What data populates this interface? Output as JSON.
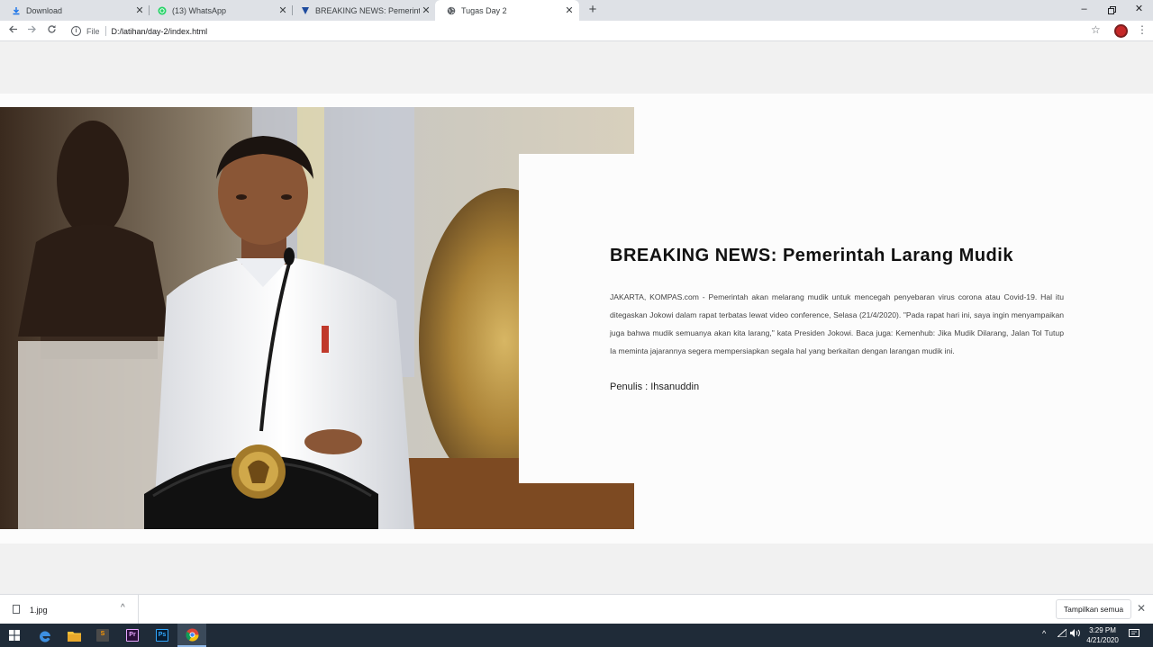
{
  "browser": {
    "tabs": [
      {
        "title": "Download",
        "icon": "download-icon",
        "active": false
      },
      {
        "title": "(13) WhatsApp",
        "icon": "whatsapp-icon",
        "active": false
      },
      {
        "title": "BREAKING NEWS: Pemerintah La",
        "icon": "news-favicon-icon",
        "active": false
      },
      {
        "title": "Tugas Day 2",
        "icon": "globe-icon",
        "active": true
      }
    ],
    "address": {
      "protocol": "File",
      "url": "D:/latihan/day-2/index.html"
    }
  },
  "article": {
    "headline": "BREAKING NEWS: Pemerintah Larang Mudik",
    "body": "JAKARTA, KOMPAS.com - Pemerintah akan melarang mudik untuk mencegah penyebaran virus corona atau Covid-19. Hal itu ditegaskan Jokowi dalam rapat terbatas lewat video conference, Selasa (21/4/2020). \"Pada rapat hari ini, saya ingin menyampaikan juga bahwa mudik semuanya akan kita larang,\" kata Presiden Jokowi. Baca juga: Kemenhub: Jika Mudik Dilarang, Jalan Tol Tutup Ia meminta jajarannya segera mempersiapkan segala hal yang berkaitan dengan larangan mudik ini.",
    "author": "Penulis : Ihsanuddin"
  },
  "download_shelf": {
    "file_name": "1.jpg",
    "show_all_label": "Tampilkan semua"
  },
  "taskbar": {
    "time": "3:29 PM",
    "date": "4/21/2020",
    "apps": [
      "windows-start-icon",
      "edge-icon",
      "file-explorer-icon",
      "sublime-text-icon",
      "premiere-pro-icon",
      "photoshop-icon",
      "chrome-icon"
    ]
  },
  "colors": {
    "page_background": "#f1f1f1",
    "card_background": "#fcfcfc",
    "tabbar": "#dee1e6",
    "taskbar": "#1f2b38"
  }
}
